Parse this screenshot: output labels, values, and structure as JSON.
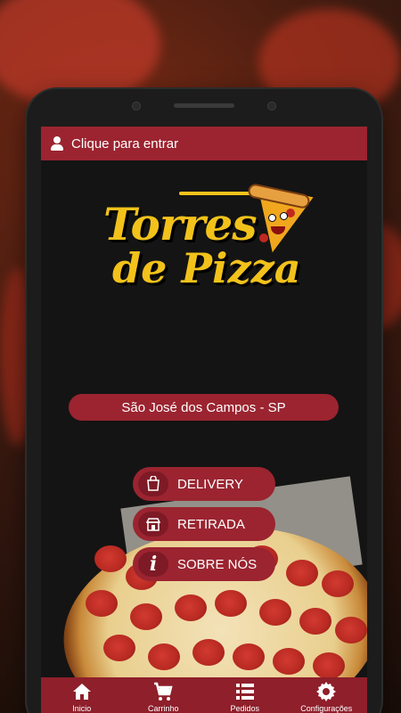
{
  "header": {
    "login_label": "Clique para entrar"
  },
  "brand": {
    "line1": "Torres",
    "line2": "de Pizza"
  },
  "location": {
    "city": "São José dos Campos - SP"
  },
  "menu": [
    {
      "label": "DELIVERY",
      "icon": "delivery-bag-icon"
    },
    {
      "label": "RETIRADA",
      "icon": "store-icon"
    },
    {
      "label": "SOBRE NÓS",
      "icon": "info-icon"
    }
  ],
  "bottom_nav": [
    {
      "label": "Inicio",
      "icon": "home-icon"
    },
    {
      "label": "Carrinho",
      "icon": "cart-icon"
    },
    {
      "label": "Pedidos",
      "icon": "list-icon"
    },
    {
      "label": "Configurações",
      "icon": "gear-icon"
    }
  ],
  "colors": {
    "primary": "#9b2430",
    "dark": "#141414",
    "logo_yellow": "#f2c21b"
  }
}
